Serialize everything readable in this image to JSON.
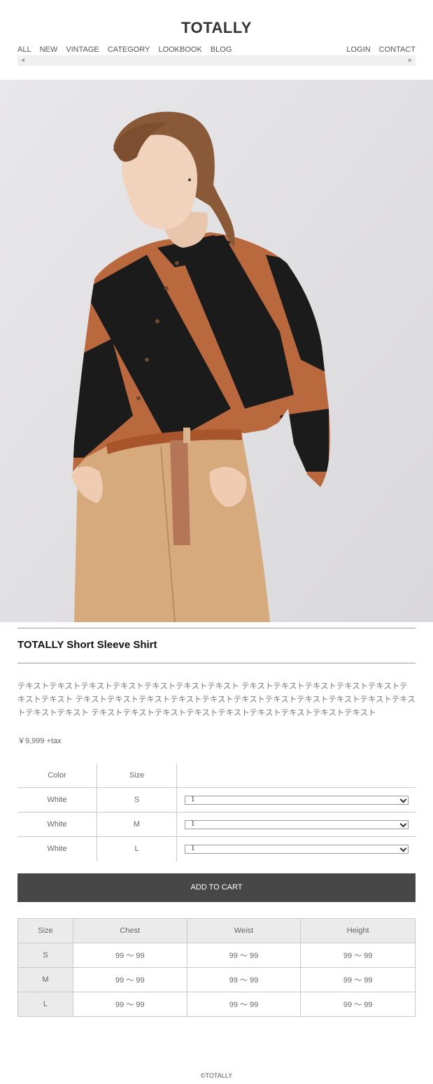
{
  "header": {
    "logo": "TOTALLY",
    "nav_left": [
      "ALL",
      "NEW",
      "VINTAGE",
      "CATEGORY",
      "LOOKBOOK",
      "BLOG"
    ],
    "nav_right": [
      "LOGIN",
      "CONTACT"
    ]
  },
  "product": {
    "title": "TOTALLY Short Sleeve Shirt",
    "description": "テキストテキストテキストテキストテキストテキストテキスト テキストテキストテキストテキストテキストテキストテキスト テキストテキストテキストテキストテキストテキストテキストテキストテキストテキストテキストテキストテキスト テキストテキストテキストテキストテキストテキストテキストテキストテキスト",
    "price": "￥9,999 +tax",
    "image_alt": "model-wearing-striped-shirt"
  },
  "variants": {
    "headers": [
      "Color",
      "Size",
      ""
    ],
    "rows": [
      {
        "color": "White",
        "size": "S",
        "qty": "1"
      },
      {
        "color": "White",
        "size": "M",
        "qty": "1"
      },
      {
        "color": "White",
        "size": "L",
        "qty": "1"
      }
    ]
  },
  "cart": {
    "label": "ADD TO CART"
  },
  "size_chart": {
    "headers": [
      "Size",
      "Chest",
      "Weist",
      "Height"
    ],
    "rows": [
      {
        "size": "S",
        "chest": "99 ～ 99",
        "weist": "99 ～ 99",
        "height": "99 ～ 99"
      },
      {
        "size": "M",
        "chest": "99 ～ 99",
        "weist": "99 ～ 99",
        "height": "99 ～ 99"
      },
      {
        "size": "L",
        "chest": "99 ～ 99",
        "weist": "99 ～ 99",
        "height": "99 ～ 99"
      }
    ]
  },
  "footer": {
    "copyright": "©TOTALLY"
  },
  "colors": {
    "button": "#474747",
    "stripe_orange": "#b9693d",
    "stripe_black": "#1b1b1b",
    "pants": "#d6aa7c"
  }
}
